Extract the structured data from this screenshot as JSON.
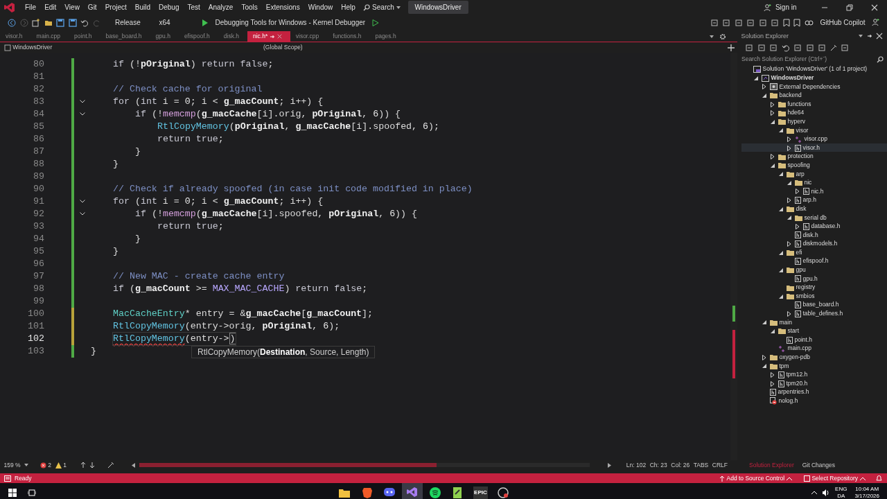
{
  "window": {
    "menu": [
      "File",
      "Edit",
      "View",
      "Git",
      "Project",
      "Build",
      "Debug",
      "Test",
      "Analyze",
      "Tools",
      "Extensions",
      "Window",
      "Help"
    ],
    "search": "Search",
    "solution": "WindowsDriver",
    "sign_in": "Sign in"
  },
  "toolbar": {
    "configuration": "Release",
    "platform": "x64",
    "debug_target": "Debugging Tools for Windows - Kernel Debugger",
    "copilot": "GitHub Copilot"
  },
  "tabs": [
    {
      "label": "visor.h",
      "selected": false,
      "pinned": false
    },
    {
      "label": "main.cpp",
      "selected": false,
      "pinned": false
    },
    {
      "label": "point.h",
      "selected": false,
      "pinned": false
    },
    {
      "label": "base_board.h",
      "selected": false,
      "pinned": false
    },
    {
      "label": "gpu.h",
      "selected": false,
      "pinned": false
    },
    {
      "label": "efispoof.h",
      "selected": false,
      "pinned": false
    },
    {
      "label": "disk.h",
      "selected": false,
      "pinned": false
    },
    {
      "label": "nic.h*",
      "selected": true,
      "pinned": true
    },
    {
      "label": "visor.cpp",
      "selected": false,
      "pinned": false
    },
    {
      "label": "functions.h",
      "selected": false,
      "pinned": false
    },
    {
      "label": "pages.h",
      "selected": false,
      "pinned": false
    }
  ],
  "navigation": {
    "project": "WindowsDriver",
    "scope": "(Global Scope)"
  },
  "editor": {
    "lines": [
      {
        "number": "80",
        "unsaved": false,
        "fold": false,
        "current": false,
        "kind": "indent1",
        "tokens": [
          {
            "text": "if",
            "kind": "kw"
          },
          {
            "text": " (!",
            "kind": "p"
          },
          {
            "text": "pOriginal",
            "kind": "var"
          },
          {
            "text": ") ",
            "kind": "p"
          },
          {
            "text": "return",
            "kind": "kw"
          },
          {
            "text": " false",
            "kind": "kw"
          },
          {
            "text": ";",
            "kind": "p"
          }
        ]
      },
      {
        "number": "81",
        "unsaved": false,
        "fold": false,
        "current": false,
        "kind": "flush"
      },
      {
        "number": "82",
        "unsaved": false,
        "fold": false,
        "current": false,
        "kind": "indent1",
        "tokens": [
          {
            "text": "// Check cache for original",
            "kind": "cm"
          }
        ]
      },
      {
        "number": "83",
        "unsaved": false,
        "fold": true,
        "current": false,
        "kind": "indent1",
        "tokens": [
          {
            "text": "for",
            "kind": "kw"
          },
          {
            "text": " (",
            "kind": "p"
          },
          {
            "text": "int",
            "kind": "kw"
          },
          {
            "text": " i = ",
            "kind": "p"
          },
          {
            "text": "0",
            "kind": "num"
          },
          {
            "text": "; i < ",
            "kind": "p"
          },
          {
            "text": "g_macCount",
            "kind": "var"
          },
          {
            "text": "; i++) {",
            "kind": "p"
          }
        ]
      },
      {
        "number": "84",
        "unsaved": false,
        "fold": true,
        "current": false,
        "kind": "indent2",
        "tokens": [
          {
            "text": "if",
            "kind": "kw"
          },
          {
            "text": " (!",
            "kind": "p"
          },
          {
            "text": "memcmp",
            "kind": "fn2"
          },
          {
            "text": "(",
            "kind": "p"
          },
          {
            "text": "g_macCache",
            "kind": "var"
          },
          {
            "text": "[i].orig, ",
            "kind": "p"
          },
          {
            "text": "pOriginal",
            "kind": "var"
          },
          {
            "text": ", ",
            "kind": "p"
          },
          {
            "text": "6",
            "kind": "num"
          },
          {
            "text": ")) {",
            "kind": "p"
          }
        ]
      },
      {
        "number": "85",
        "unsaved": false,
        "fold": false,
        "current": false,
        "kind": "indent3",
        "tokens": [
          {
            "text": "RtlCopyMemory",
            "kind": "fn"
          },
          {
            "text": "(",
            "kind": "p"
          },
          {
            "text": "pOriginal",
            "kind": "var"
          },
          {
            "text": ", ",
            "kind": "p"
          },
          {
            "text": "g_macCache",
            "kind": "var"
          },
          {
            "text": "[i].spoofed, ",
            "kind": "p"
          },
          {
            "text": "6",
            "kind": "num"
          },
          {
            "text": ");",
            "kind": "p"
          }
        ]
      },
      {
        "number": "86",
        "unsaved": false,
        "fold": false,
        "current": false,
        "kind": "indent3",
        "tokens": [
          {
            "text": "return",
            "kind": "kw"
          },
          {
            "text": " true",
            "kind": "kw"
          },
          {
            "text": ";",
            "kind": "p"
          }
        ]
      },
      {
        "number": "87",
        "unsaved": false,
        "fold": false,
        "current": false,
        "kind": "indent2",
        "tokens": [
          {
            "text": "}",
            "kind": "p"
          }
        ]
      },
      {
        "number": "88",
        "unsaved": false,
        "fold": false,
        "current": false,
        "kind": "indent1",
        "tokens": [
          {
            "text": "}",
            "kind": "p"
          }
        ]
      },
      {
        "number": "89",
        "unsaved": false,
        "fold": false,
        "current": false,
        "kind": "flush"
      },
      {
        "number": "90",
        "unsaved": false,
        "fold": false,
        "current": false,
        "kind": "indent1",
        "tokens": [
          {
            "text": "// Check if already spoofed (in case init code modified in place)",
            "kind": "cm"
          }
        ]
      },
      {
        "number": "91",
        "unsaved": false,
        "fold": true,
        "current": false,
        "kind": "indent1",
        "tokens": [
          {
            "text": "for",
            "kind": "kw"
          },
          {
            "text": " (",
            "kind": "p"
          },
          {
            "text": "int",
            "kind": "kw"
          },
          {
            "text": " i = ",
            "kind": "p"
          },
          {
            "text": "0",
            "kind": "num"
          },
          {
            "text": "; i < ",
            "kind": "p"
          },
          {
            "text": "g_macCount",
            "kind": "var"
          },
          {
            "text": "; i++) {",
            "kind": "p"
          }
        ]
      },
      {
        "number": "92",
        "unsaved": false,
        "fold": true,
        "current": false,
        "kind": "indent2",
        "tokens": [
          {
            "text": "if",
            "kind": "kw"
          },
          {
            "text": " (!",
            "kind": "p"
          },
          {
            "text": "memcmp",
            "kind": "fn2"
          },
          {
            "text": "(",
            "kind": "p"
          },
          {
            "text": "g_macCache",
            "kind": "var"
          },
          {
            "text": "[i].spoofed, ",
            "kind": "p"
          },
          {
            "text": "pOriginal",
            "kind": "var"
          },
          {
            "text": ", ",
            "kind": "p"
          },
          {
            "text": "6",
            "kind": "num"
          },
          {
            "text": ")) {",
            "kind": "p"
          }
        ]
      },
      {
        "number": "93",
        "unsaved": false,
        "fold": false,
        "current": false,
        "kind": "indent3",
        "tokens": [
          {
            "text": "return",
            "kind": "kw"
          },
          {
            "text": " true",
            "kind": "kw"
          },
          {
            "text": ";",
            "kind": "p"
          }
        ]
      },
      {
        "number": "94",
        "unsaved": false,
        "fold": false,
        "current": false,
        "kind": "indent2",
        "tokens": [
          {
            "text": "}",
            "kind": "p"
          }
        ]
      },
      {
        "number": "95",
        "unsaved": false,
        "fold": false,
        "current": false,
        "kind": "indent1",
        "tokens": [
          {
            "text": "}",
            "kind": "p"
          }
        ]
      },
      {
        "number": "96",
        "unsaved": false,
        "fold": false,
        "current": false,
        "kind": "flush"
      },
      {
        "number": "97",
        "unsaved": false,
        "fold": false,
        "current": false,
        "kind": "indent1",
        "tokens": [
          {
            "text": "// New MAC - create cache entry",
            "kind": "cm"
          }
        ]
      },
      {
        "number": "98",
        "unsaved": false,
        "fold": false,
        "current": false,
        "kind": "indent1",
        "tokens": [
          {
            "text": "if",
            "kind": "kw"
          },
          {
            "text": " (",
            "kind": "p"
          },
          {
            "text": "g_macCount",
            "kind": "var"
          },
          {
            "text": " >= ",
            "kind": "p"
          },
          {
            "text": "MAX_MAC_CACHE",
            "kind": "mac"
          },
          {
            "text": ") ",
            "kind": "p"
          },
          {
            "text": "return",
            "kind": "kw"
          },
          {
            "text": " false",
            "kind": "kw"
          },
          {
            "text": ";",
            "kind": "p"
          }
        ]
      },
      {
        "number": "99",
        "unsaved": false,
        "fold": false,
        "current": false,
        "kind": "flush"
      },
      {
        "number": "100",
        "unsaved": true,
        "fold": false,
        "current": false,
        "kind": "indent1",
        "tokens": [
          {
            "text": "MacCacheEntry",
            "kind": "ty"
          },
          {
            "text": "* entry = &",
            "kind": "p"
          },
          {
            "text": "g_macCache",
            "kind": "var"
          },
          {
            "text": "[",
            "kind": "p"
          },
          {
            "text": "g_macCount",
            "kind": "var"
          },
          {
            "text": "];",
            "kind": "p"
          }
        ]
      },
      {
        "number": "101",
        "unsaved": true,
        "fold": false,
        "current": false,
        "kind": "indent1",
        "tokens": [
          {
            "text": "RtlCopyMemory",
            "kind": "fn"
          },
          {
            "text": "(entry->orig, ",
            "kind": "p"
          },
          {
            "text": "pOriginal",
            "kind": "var"
          },
          {
            "text": ", ",
            "kind": "p"
          },
          {
            "text": "6",
            "kind": "num"
          },
          {
            "text": ");",
            "kind": "p"
          }
        ]
      },
      {
        "number": "102",
        "unsaved": true,
        "fold": false,
        "current": true,
        "kind": "indent1",
        "tokens": [
          {
            "text": "RtlCopyMemory",
            "kind": "fn_error"
          },
          {
            "text": "(entry->",
            "kind": "p"
          },
          {
            "text": ")",
            "kind": "brace_match"
          }
        ]
      },
      {
        "number": "103",
        "unsaved": false,
        "fold": false,
        "current": false,
        "kind": "flush",
        "tokens": [
          {
            "text": "}",
            "kind": "p"
          }
        ]
      }
    ],
    "parameter_info": "RtlCopyMemory(**Destination**, Source, Length)"
  },
  "editor_status": {
    "zoom": "159 %",
    "errors": "2",
    "warnings": "1",
    "line": "Ln: 102",
    "char": "Ch: 23",
    "column": "Col: 26",
    "indent": "TABS",
    "line_endings": "CRLF"
  },
  "solution_explorer": {
    "title": "Solution Explorer",
    "search": {
      "placeholder": "Search Solution Explorer (Ctrl+¨)"
    },
    "tree": [
      {
        "label": "Solution 'WindowsDriver' (1 of 1 project)",
        "kind": "solution",
        "selected": false,
        "children": [
          {
            "label": "WindowsDriver",
            "kind": "project",
            "expanded": true,
            "selected": false,
            "children": [
              {
                "label": "External Dependencies",
                "kind": "deps",
                "expanded": false,
                "selected": false
              },
              {
                "label": "backend",
                "kind": "folder",
                "expanded": true,
                "selected": false,
                "children": [
                  {
                    "label": "functions",
                    "kind": "folder",
                    "expanded": false,
                    "selected": false
                  },
                  {
                    "label": "hde64",
                    "kind": "folder",
                    "expanded": false,
                    "selected": false
                  },
                  {
                    "label": "hyperv",
                    "kind": "folder",
                    "expanded": true,
                    "selected": false,
                    "children": [
                      {
                        "label": "visor",
                        "kind": "folder",
                        "expanded": true,
                        "selected": false,
                        "children": [
                          {
                            "label": "visor.cpp",
                            "kind": "cpp",
                            "expanded": false,
                            "selected": false
                          },
                          {
                            "label": "visor.h",
                            "kind": "header",
                            "expanded": false,
                            "selected": true
                          }
                        ]
                      }
                    ]
                  },
                  {
                    "label": "protection",
                    "kind": "folder",
                    "expanded": false,
                    "selected": false
                  },
                  {
                    "label": "spoofing",
                    "kind": "folder",
                    "expanded": true,
                    "selected": false,
                    "children": [
                      {
                        "label": "arp",
                        "kind": "folder",
                        "expanded": true,
                        "selected": false,
                        "children": [
                          {
                            "label": "nic",
                            "kind": "folder",
                            "expanded": true,
                            "selected": false,
                            "children": [
                              {
                                "label": "nic.h",
                                "kind": "header",
                                "expanded": false,
                                "selected": false
                              }
                            ]
                          },
                          {
                            "label": "arp.h",
                            "kind": "header",
                            "expanded": false,
                            "selected": false
                          }
                        ]
                      },
                      {
                        "label": "disk",
                        "kind": "folder",
                        "expanded": true,
                        "selected": false,
                        "children": [
                          {
                            "label": "serial db",
                            "kind": "folder",
                            "expanded": true,
                            "selected": false,
                            "children": [
                              {
                                "label": "database.h",
                                "kind": "header",
                                "expanded": false,
                                "selected": false
                              }
                            ]
                          },
                          {
                            "label": "disk.h",
                            "kind": "header",
                            "selected": false
                          },
                          {
                            "label": "diskmodels.h",
                            "kind": "header",
                            "expanded": false,
                            "selected": false
                          }
                        ]
                      },
                      {
                        "label": "efi",
                        "kind": "folder",
                        "expanded": true,
                        "selected": false,
                        "children": [
                          {
                            "label": "efispoof.h",
                            "kind": "header",
                            "selected": false
                          }
                        ]
                      },
                      {
                        "label": "gpu",
                        "kind": "folder",
                        "expanded": true,
                        "selected": false,
                        "children": [
                          {
                            "label": "gpu.h",
                            "kind": "header",
                            "selected": false
                          }
                        ]
                      },
                      {
                        "label": "registry",
                        "kind": "folder",
                        "selected": false
                      },
                      {
                        "label": "smbios",
                        "kind": "folder",
                        "expanded": true,
                        "selected": false,
                        "children": [
                          {
                            "label": "base_board.h",
                            "kind": "header",
                            "selected": false
                          },
                          {
                            "label": "table_defines.h",
                            "kind": "header",
                            "expanded": false,
                            "selected": false
                          }
                        ]
                      }
                    ]
                  }
                ]
              },
              {
                "label": "main",
                "kind": "folder",
                "expanded": true,
                "selected": false,
                "children": [
                  {
                    "label": "start",
                    "kind": "folder",
                    "expanded": true,
                    "selected": false,
                    "children": [
                      {
                        "label": "point.h",
                        "kind": "header",
                        "selected": false
                      }
                    ]
                  },
                  {
                    "label": "main.cpp",
                    "kind": "cpp",
                    "selected": false
                  }
                ]
              },
              {
                "label": "oxygen-pdb",
                "kind": "folder",
                "expanded": false,
                "selected": false
              },
              {
                "label": "tpm",
                "kind": "folder",
                "expanded": true,
                "selected": false,
                "children": [
                  {
                    "label": "tpm12.h",
                    "kind": "header",
                    "expanded": false,
                    "selected": false
                  },
                  {
                    "label": "tpm20.h",
                    "kind": "header",
                    "expanded": false,
                    "selected": false
                  }
                ]
              },
              {
                "label": "arpentries.h",
                "kind": "header",
                "selected": false
              },
              {
                "label": "nolog.h",
                "kind": "excluded",
                "selected": false
              }
            ]
          }
        ]
      }
    ],
    "panel_tabs": [
      {
        "label": "Solution Explorer",
        "selected": true
      },
      {
        "label": "Git Changes",
        "selected": false
      }
    ]
  },
  "status_bar": {
    "text": "Ready",
    "source_control": "Add to Source Control",
    "repository": "Select Repository"
  },
  "taskbar": {
    "apps": [
      {
        "kind": "files",
        "active": false
      },
      {
        "kind": "browser",
        "active": false
      },
      {
        "kind": "chat",
        "active": false
      },
      {
        "kind": "ide",
        "active": true
      },
      {
        "kind": "music",
        "active": false
      },
      {
        "kind": "editor",
        "active": false
      },
      {
        "kind": "store",
        "label": "EPIC",
        "active": false
      },
      {
        "kind": "launcher",
        "active": false
      }
    ],
    "language": "ENG",
    "layout": "DA",
    "time": "10:04 AM",
    "date": "3/17/2026"
  }
}
